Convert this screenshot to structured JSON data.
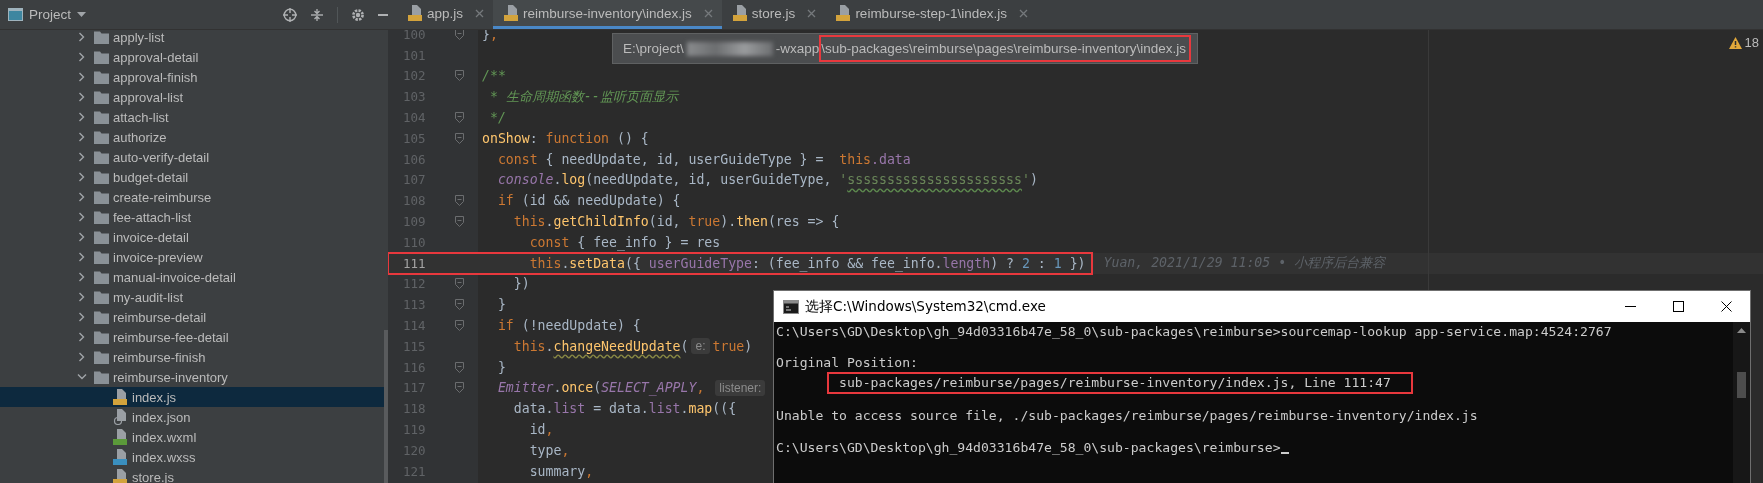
{
  "project_panel": {
    "title": "Project",
    "items": [
      {
        "label": "apply-list",
        "kind": "folder",
        "expanded": false,
        "selected": false
      },
      {
        "label": "approval-detail",
        "kind": "folder",
        "expanded": false,
        "selected": false
      },
      {
        "label": "approval-finish",
        "kind": "folder",
        "expanded": false,
        "selected": false
      },
      {
        "label": "approval-list",
        "kind": "folder",
        "expanded": false,
        "selected": false
      },
      {
        "label": "attach-list",
        "kind": "folder",
        "expanded": false,
        "selected": false
      },
      {
        "label": "authorize",
        "kind": "folder",
        "expanded": false,
        "selected": false
      },
      {
        "label": "auto-verify-detail",
        "kind": "folder",
        "expanded": false,
        "selected": false
      },
      {
        "label": "budget-detail",
        "kind": "folder",
        "expanded": false,
        "selected": false
      },
      {
        "label": "create-reimburse",
        "kind": "folder",
        "expanded": false,
        "selected": false
      },
      {
        "label": "fee-attach-list",
        "kind": "folder",
        "expanded": false,
        "selected": false
      },
      {
        "label": "invoice-detail",
        "kind": "folder",
        "expanded": false,
        "selected": false
      },
      {
        "label": "invoice-preview",
        "kind": "folder",
        "expanded": false,
        "selected": false
      },
      {
        "label": "manual-invoice-detail",
        "kind": "folder",
        "expanded": false,
        "selected": false
      },
      {
        "label": "my-audit-list",
        "kind": "folder",
        "expanded": false,
        "selected": false
      },
      {
        "label": "reimburse-detail",
        "kind": "folder",
        "expanded": false,
        "selected": false
      },
      {
        "label": "reimburse-fee-detail",
        "kind": "folder",
        "expanded": false,
        "selected": false
      },
      {
        "label": "reimburse-finish",
        "kind": "folder",
        "expanded": false,
        "selected": false
      },
      {
        "label": "reimburse-inventory",
        "kind": "folder",
        "expanded": true,
        "selected": false,
        "children": [
          {
            "label": "index.js",
            "kind": "js",
            "selected": true
          },
          {
            "label": "index.json",
            "kind": "json",
            "selected": false
          },
          {
            "label": "index.wxml",
            "kind": "wxml",
            "selected": false
          },
          {
            "label": "index.wxss",
            "kind": "wxss",
            "selected": false
          },
          {
            "label": "store.js",
            "kind": "js",
            "selected": false
          }
        ]
      }
    ]
  },
  "tabs": [
    {
      "label": "app.js",
      "selected": false
    },
    {
      "label": "reimburse-inventory\\index.js",
      "selected": true
    },
    {
      "label": "store.js",
      "selected": false
    },
    {
      "label": "reimburse-step-1\\index.js",
      "selected": false
    }
  ],
  "editor": {
    "tooltip": {
      "prefix": "E:\\project\\",
      "suffix": "-wxapp",
      "highlighted_path": "\\sub-packages\\reimburse\\pages\\reimburse-inventory\\index.js"
    },
    "warning_count": "18",
    "lines": [
      {
        "number": "100",
        "fold": true,
        "highlighted": false,
        "tokens": [
          {
            "kind": "plain",
            "text": "}"
          },
          {
            "kind": "keyword",
            "text": ","
          }
        ]
      },
      {
        "number": "101",
        "fold": false,
        "highlighted": false
      },
      {
        "number": "102",
        "fold": true,
        "highlighted": false,
        "tokens": [
          {
            "kind": "doc",
            "text": "/**"
          }
        ]
      },
      {
        "number": "103",
        "fold": false,
        "highlighted": false,
        "tokens": [
          {
            "kind": "doc",
            "text": " * 生命周期函数--监听页面显示"
          }
        ]
      },
      {
        "number": "104",
        "fold": true,
        "highlighted": false,
        "tokens": [
          {
            "kind": "doc",
            "text": " */"
          }
        ]
      },
      {
        "number": "105",
        "fold": true,
        "highlighted": false,
        "tokens": [
          {
            "kind": "method",
            "text": "onShow"
          },
          {
            "kind": "plain",
            "text": ": "
          },
          {
            "kind": "keyword",
            "text": "function"
          },
          {
            "kind": "plain",
            "text": " () {"
          }
        ]
      },
      {
        "number": "106",
        "fold": false,
        "highlighted": false,
        "tokens": [
          {
            "kind": "keyword",
            "text": "  const"
          },
          {
            "kind": "plain",
            "text": " { needUpdate, id, userGuideType } =  "
          },
          {
            "kind": "keyword",
            "text": "this"
          },
          {
            "kind": "field",
            "text": ".data"
          }
        ]
      },
      {
        "number": "107",
        "fold": false,
        "highlighted": false,
        "tokens": [
          {
            "kind": "global",
            "text": "  console"
          },
          {
            "kind": "plain",
            "text": "."
          },
          {
            "kind": "method",
            "text": "log"
          },
          {
            "kind": "plain",
            "text": "(needUpdate, id, userGuideType, "
          },
          {
            "kind": "string",
            "text": "'"
          },
          {
            "kind": "misspelled",
            "text": "ssssssssssssssssssssss"
          },
          {
            "kind": "string",
            "text": "'"
          },
          {
            "kind": "plain",
            "text": ")"
          }
        ]
      },
      {
        "number": "108",
        "fold": true,
        "highlighted": false,
        "tokens": [
          {
            "kind": "keyword",
            "text": "  if"
          },
          {
            "kind": "plain",
            "text": " (id && needUpdate) {"
          }
        ]
      },
      {
        "number": "109",
        "fold": true,
        "highlighted": false,
        "tokens": [
          {
            "kind": "keyword",
            "text": "    this"
          },
          {
            "kind": "plain",
            "text": "."
          },
          {
            "kind": "method",
            "text": "getChildInfo"
          },
          {
            "kind": "plain",
            "text": "(id, "
          },
          {
            "kind": "keyword",
            "text": "true"
          },
          {
            "kind": "plain",
            "text": ")."
          },
          {
            "kind": "method",
            "text": "then"
          },
          {
            "kind": "plain",
            "text": "(res => {"
          }
        ]
      },
      {
        "number": "110",
        "fold": false,
        "highlighted": false,
        "tokens": [
          {
            "kind": "keyword",
            "text": "      const"
          },
          {
            "kind": "plain",
            "text": " { fee_info } = res"
          }
        ]
      },
      {
        "number": "111",
        "fold": false,
        "highlighted": true,
        "blame": "Yuan, 2021/1/29 11:05 • 小程序后台兼容",
        "tokens": [
          {
            "kind": "keyword",
            "text": "      this"
          },
          {
            "kind": "plain",
            "text": "."
          },
          {
            "kind": "method",
            "text": "setData"
          },
          {
            "kind": "plain",
            "text": "({ "
          },
          {
            "kind": "field",
            "text": "userGuideType"
          },
          {
            "kind": "plain",
            "text": ": (fee_info && fee_info."
          },
          {
            "kind": "field",
            "text": "length"
          },
          {
            "kind": "plain",
            "text": ") ? "
          },
          {
            "kind": "number",
            "text": "2"
          },
          {
            "kind": "plain",
            "text": " : "
          },
          {
            "kind": "number",
            "text": "1"
          },
          {
            "kind": "plain",
            "text": " })"
          }
        ]
      },
      {
        "number": "112",
        "fold": true,
        "highlighted": false,
        "tokens": [
          {
            "kind": "plain",
            "text": "    })"
          }
        ]
      },
      {
        "number": "113",
        "fold": true,
        "highlighted": false,
        "tokens": [
          {
            "kind": "plain",
            "text": "  }"
          }
        ]
      },
      {
        "number": "114",
        "fold": true,
        "highlighted": false,
        "tokens": [
          {
            "kind": "keyword",
            "text": "  if"
          },
          {
            "kind": "plain",
            "text": " (!needUpdate) {"
          }
        ]
      },
      {
        "number": "115",
        "fold": false,
        "highlighted": false,
        "tokens": [
          {
            "kind": "keyword",
            "text": "    this"
          },
          {
            "kind": "plain",
            "text": "."
          },
          {
            "kind": "flagged",
            "text": "changeNeedUpdate"
          },
          {
            "kind": "plain",
            "text": "("
          },
          {
            "kind": "hint",
            "text": "e:"
          },
          {
            "kind": "keyword",
            "text": "true"
          },
          {
            "kind": "plain",
            "text": ")"
          }
        ]
      },
      {
        "number": "116",
        "fold": true,
        "highlighted": false,
        "tokens": [
          {
            "kind": "plain",
            "text": "  }"
          }
        ]
      },
      {
        "number": "117",
        "fold": true,
        "highlighted": false,
        "tokens": [
          {
            "kind": "global",
            "text": "  Emitter"
          },
          {
            "kind": "plain",
            "text": "."
          },
          {
            "kind": "method",
            "text": "once"
          },
          {
            "kind": "plain",
            "text": "("
          },
          {
            "kind": "global",
            "text": "SELECT_APPLY"
          },
          {
            "kind": "keyword",
            "text": ", "
          },
          {
            "kind": "hint",
            "text": "listener:"
          }
        ]
      },
      {
        "number": "118",
        "fold": false,
        "highlighted": false,
        "tokens": [
          {
            "kind": "plain",
            "text": "    data."
          },
          {
            "kind": "field",
            "text": "list"
          },
          {
            "kind": "plain",
            "text": " = data."
          },
          {
            "kind": "field",
            "text": "list"
          },
          {
            "kind": "plain",
            "text": "."
          },
          {
            "kind": "method",
            "text": "map"
          },
          {
            "kind": "plain",
            "text": "(({"
          }
        ]
      },
      {
        "number": "119",
        "fold": false,
        "highlighted": false,
        "tokens": [
          {
            "kind": "plain",
            "text": "      id"
          },
          {
            "kind": "keyword",
            "text": ","
          }
        ]
      },
      {
        "number": "120",
        "fold": false,
        "highlighted": false,
        "tokens": [
          {
            "kind": "plain",
            "text": "      type"
          },
          {
            "kind": "keyword",
            "text": ","
          }
        ]
      },
      {
        "number": "121",
        "fold": false,
        "highlighted": false,
        "tokens": [
          {
            "kind": "plain",
            "text": "      summary"
          },
          {
            "kind": "keyword",
            "text": ","
          }
        ]
      }
    ]
  },
  "console_window": {
    "title": "选择C:\\Windows\\System32\\cmd.exe",
    "lines": [
      {
        "kind": "command",
        "highlighted": false,
        "text": "C:\\Users\\GD\\Desktop\\gh_94d03316b47e_58_0\\sub-packages\\reimburse>sourcemap-lookup app-service.map:4524:2767"
      },
      {
        "kind": "blank"
      },
      {
        "kind": "output",
        "highlighted": false,
        "text": "Original Position:"
      },
      {
        "kind": "location",
        "highlighted": true,
        "text": "sub-packages/reimburse/pages/reimburse-inventory/index.js, Line 111:47"
      },
      {
        "kind": "blank"
      },
      {
        "kind": "output",
        "highlighted": false,
        "text": "Unable to access source file, ./sub-packages/reimburse/pages/reimburse-inventory/index.js"
      },
      {
        "kind": "blank"
      },
      {
        "kind": "prompt",
        "highlighted": false,
        "text": "C:\\Users\\GD\\Desktop\\gh_94d03316b47e_58_0\\sub-packages\\reimburse>"
      }
    ]
  }
}
